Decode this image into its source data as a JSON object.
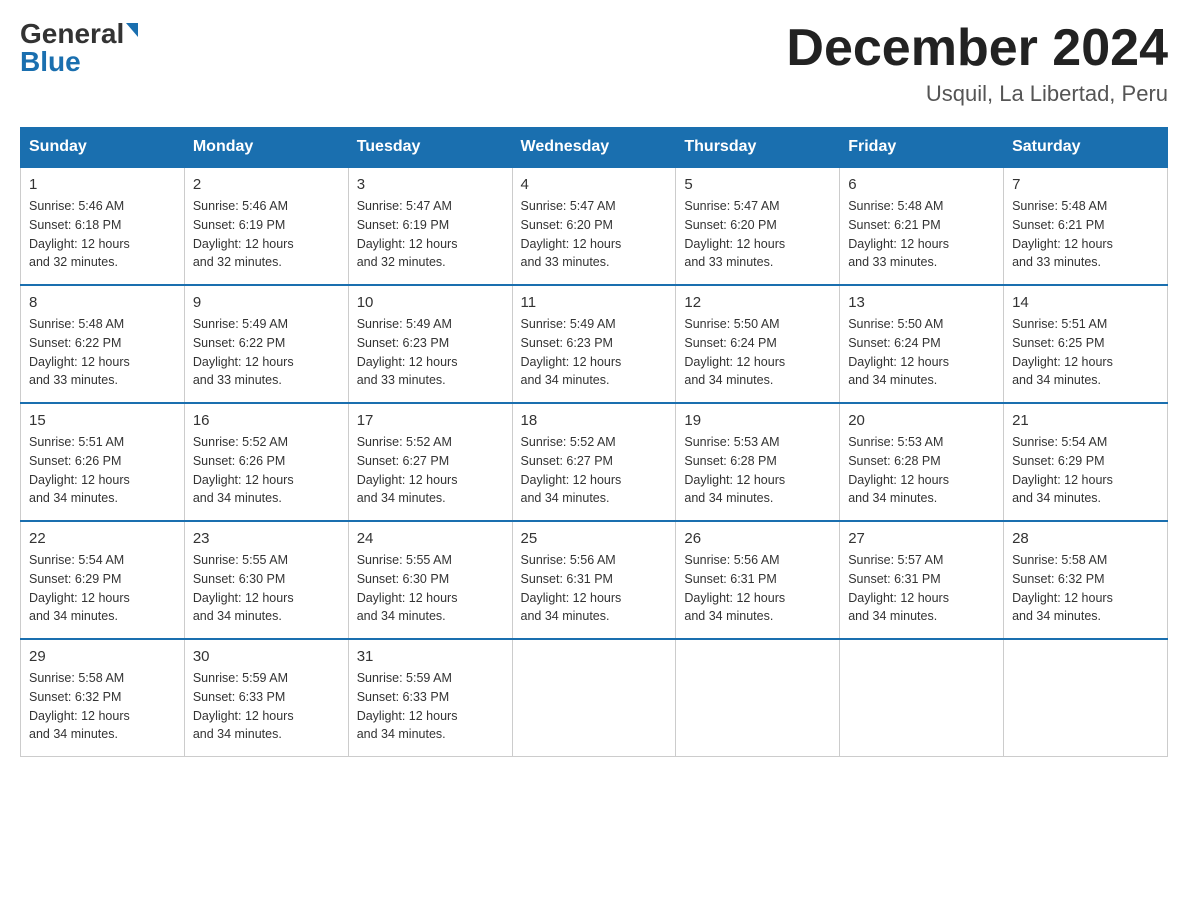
{
  "logo": {
    "general": "General",
    "blue": "Blue"
  },
  "header": {
    "title": "December 2024",
    "subtitle": "Usquil, La Libertad, Peru"
  },
  "days_of_week": [
    "Sunday",
    "Monday",
    "Tuesday",
    "Wednesday",
    "Thursday",
    "Friday",
    "Saturday"
  ],
  "weeks": [
    [
      {
        "day": "1",
        "sunrise": "5:46 AM",
        "sunset": "6:18 PM",
        "daylight": "12 hours and 32 minutes."
      },
      {
        "day": "2",
        "sunrise": "5:46 AM",
        "sunset": "6:19 PM",
        "daylight": "12 hours and 32 minutes."
      },
      {
        "day": "3",
        "sunrise": "5:47 AM",
        "sunset": "6:19 PM",
        "daylight": "12 hours and 32 minutes."
      },
      {
        "day": "4",
        "sunrise": "5:47 AM",
        "sunset": "6:20 PM",
        "daylight": "12 hours and 33 minutes."
      },
      {
        "day": "5",
        "sunrise": "5:47 AM",
        "sunset": "6:20 PM",
        "daylight": "12 hours and 33 minutes."
      },
      {
        "day": "6",
        "sunrise": "5:48 AM",
        "sunset": "6:21 PM",
        "daylight": "12 hours and 33 minutes."
      },
      {
        "day": "7",
        "sunrise": "5:48 AM",
        "sunset": "6:21 PM",
        "daylight": "12 hours and 33 minutes."
      }
    ],
    [
      {
        "day": "8",
        "sunrise": "5:48 AM",
        "sunset": "6:22 PM",
        "daylight": "12 hours and 33 minutes."
      },
      {
        "day": "9",
        "sunrise": "5:49 AM",
        "sunset": "6:22 PM",
        "daylight": "12 hours and 33 minutes."
      },
      {
        "day": "10",
        "sunrise": "5:49 AM",
        "sunset": "6:23 PM",
        "daylight": "12 hours and 33 minutes."
      },
      {
        "day": "11",
        "sunrise": "5:49 AM",
        "sunset": "6:23 PM",
        "daylight": "12 hours and 34 minutes."
      },
      {
        "day": "12",
        "sunrise": "5:50 AM",
        "sunset": "6:24 PM",
        "daylight": "12 hours and 34 minutes."
      },
      {
        "day": "13",
        "sunrise": "5:50 AM",
        "sunset": "6:24 PM",
        "daylight": "12 hours and 34 minutes."
      },
      {
        "day": "14",
        "sunrise": "5:51 AM",
        "sunset": "6:25 PM",
        "daylight": "12 hours and 34 minutes."
      }
    ],
    [
      {
        "day": "15",
        "sunrise": "5:51 AM",
        "sunset": "6:26 PM",
        "daylight": "12 hours and 34 minutes."
      },
      {
        "day": "16",
        "sunrise": "5:52 AM",
        "sunset": "6:26 PM",
        "daylight": "12 hours and 34 minutes."
      },
      {
        "day": "17",
        "sunrise": "5:52 AM",
        "sunset": "6:27 PM",
        "daylight": "12 hours and 34 minutes."
      },
      {
        "day": "18",
        "sunrise": "5:52 AM",
        "sunset": "6:27 PM",
        "daylight": "12 hours and 34 minutes."
      },
      {
        "day": "19",
        "sunrise": "5:53 AM",
        "sunset": "6:28 PM",
        "daylight": "12 hours and 34 minutes."
      },
      {
        "day": "20",
        "sunrise": "5:53 AM",
        "sunset": "6:28 PM",
        "daylight": "12 hours and 34 minutes."
      },
      {
        "day": "21",
        "sunrise": "5:54 AM",
        "sunset": "6:29 PM",
        "daylight": "12 hours and 34 minutes."
      }
    ],
    [
      {
        "day": "22",
        "sunrise": "5:54 AM",
        "sunset": "6:29 PM",
        "daylight": "12 hours and 34 minutes."
      },
      {
        "day": "23",
        "sunrise": "5:55 AM",
        "sunset": "6:30 PM",
        "daylight": "12 hours and 34 minutes."
      },
      {
        "day": "24",
        "sunrise": "5:55 AM",
        "sunset": "6:30 PM",
        "daylight": "12 hours and 34 minutes."
      },
      {
        "day": "25",
        "sunrise": "5:56 AM",
        "sunset": "6:31 PM",
        "daylight": "12 hours and 34 minutes."
      },
      {
        "day": "26",
        "sunrise": "5:56 AM",
        "sunset": "6:31 PM",
        "daylight": "12 hours and 34 minutes."
      },
      {
        "day": "27",
        "sunrise": "5:57 AM",
        "sunset": "6:31 PM",
        "daylight": "12 hours and 34 minutes."
      },
      {
        "day": "28",
        "sunrise": "5:58 AM",
        "sunset": "6:32 PM",
        "daylight": "12 hours and 34 minutes."
      }
    ],
    [
      {
        "day": "29",
        "sunrise": "5:58 AM",
        "sunset": "6:32 PM",
        "daylight": "12 hours and 34 minutes."
      },
      {
        "day": "30",
        "sunrise": "5:59 AM",
        "sunset": "6:33 PM",
        "daylight": "12 hours and 34 minutes."
      },
      {
        "day": "31",
        "sunrise": "5:59 AM",
        "sunset": "6:33 PM",
        "daylight": "12 hours and 34 minutes."
      },
      null,
      null,
      null,
      null
    ]
  ],
  "labels": {
    "sunrise": "Sunrise:",
    "sunset": "Sunset:",
    "daylight": "Daylight:"
  }
}
